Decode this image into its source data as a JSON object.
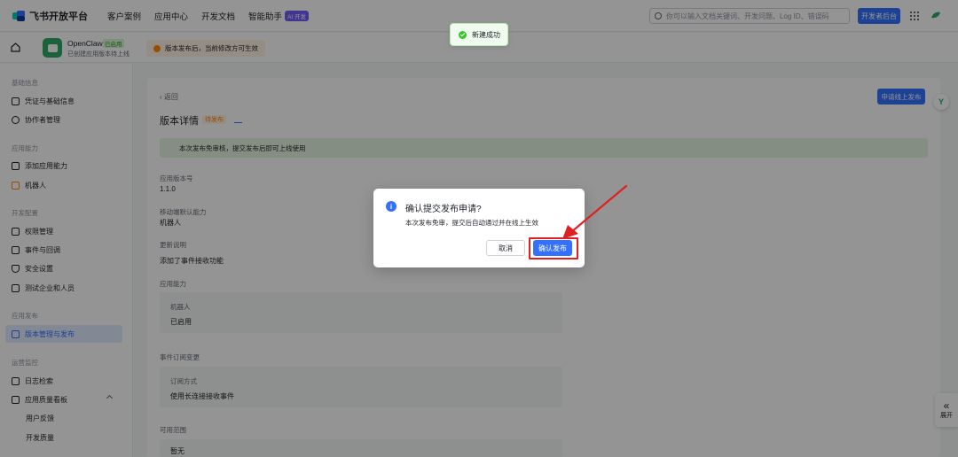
{
  "topnav": {
    "logo": "飞书开放平台",
    "links": [
      "客户案例",
      "应用中心",
      "开发文档",
      "智能助手"
    ],
    "ai_badge": "AI 开发",
    "search_placeholder": "你可以输入文档关键词、开发问题、Log ID、错误码",
    "dev_console": "开发者后台"
  },
  "toast": {
    "text": "新建成功"
  },
  "appbar": {
    "app_name": "OpenClaw",
    "app_status": "已启用",
    "app_sub": "已创建应用版本待上线",
    "warning": "版本发布后，当前修改方可生效"
  },
  "sidebar": {
    "sections": {
      "basic": "基础信息",
      "capability": "应用能力",
      "dev_config": "开发配置",
      "release": "应用发布",
      "ops": "运营监控"
    },
    "items": {
      "credentials": "凭证与基础信息",
      "collaborators": "协作者管理",
      "add_capability": "添加应用能力",
      "bot": "机器人",
      "permissions": "权限管理",
      "events": "事件与回调",
      "security": "安全设置",
      "test_enterprise": "测试企业和人员",
      "version_release": "版本管理与发布",
      "logs": "日志检索",
      "quality": "应用质量看板",
      "feedback": "用户反馈",
      "dev_quality": "开发质量"
    }
  },
  "main": {
    "back": "返回",
    "title": "版本详情",
    "tag": "待发布",
    "success_banner": "本次发布免审核，提交发布后即可上线使用",
    "version_label": "应用版本号",
    "version_value": "1.1.0",
    "ability_label": "移动端默认能力",
    "ability_value": "机器人",
    "notes_label": "更新说明",
    "notes_value": "添加了事件接收功能",
    "app_ability_label": "应用能力",
    "bot_label": "机器人",
    "bot_value": "已启用",
    "event_label": "事件订阅变更",
    "event_sub_label": "订阅方式",
    "event_sub_value": "使用长连接接收事件",
    "availability_label": "可用范围",
    "availability_value": "暂无",
    "top_right_btn": "申请线上发布"
  },
  "dialog": {
    "title": "确认提交发布申请?",
    "body": "本次发布免审，提交后自动通过并在线上生效",
    "cancel": "取消",
    "confirm": "确认发布"
  },
  "float": {
    "avatar_letter": "Y",
    "expand": "展开"
  },
  "colors": {
    "primary": "#3370ff",
    "success": "#34c724",
    "highlight": "#e02020"
  }
}
